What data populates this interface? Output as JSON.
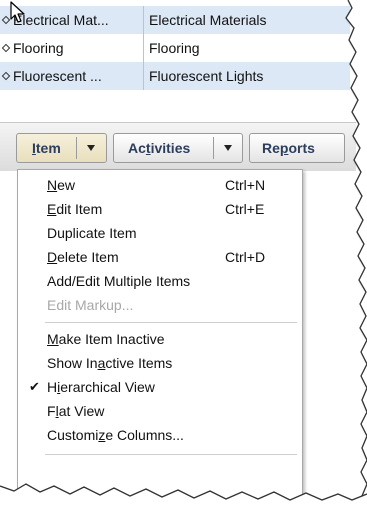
{
  "list": {
    "rows": [
      {
        "name": "Electrical Mat...",
        "description": "Electrical Materials"
      },
      {
        "name": "Flooring",
        "description": "Flooring"
      },
      {
        "name": "Fluorescent ...",
        "description": "Fluorescent Lights"
      }
    ]
  },
  "toolbar": {
    "item_pre": "",
    "item_u": "I",
    "item_post": "tem",
    "activities_pre": "Ac",
    "activities_u": "t",
    "activities_post": "ivities",
    "reports_pre": "Re",
    "reports_u": "p",
    "reports_post": "orts"
  },
  "menu": {
    "new": {
      "u": "N",
      "rest": "ew",
      "shortcut": "Ctrl+N"
    },
    "edit": {
      "u": "E",
      "rest": "dit Item",
      "shortcut": "Ctrl+E"
    },
    "duplicate": {
      "label": "Duplicate Item"
    },
    "delete": {
      "u": "D",
      "rest": "elete Item",
      "shortcut": "Ctrl+D"
    },
    "add_edit_multiple": {
      "label": "Add/Edit Multiple Items"
    },
    "edit_markup": {
      "label": "Edit Markup..."
    },
    "make_inactive": {
      "u": "M",
      "rest": "ake Item Inactive"
    },
    "show_inactive": {
      "pre": "Show In",
      "u": "a",
      "rest": "ctive Items"
    },
    "hierarchical": {
      "pre": "H",
      "u": "i",
      "rest": "erarchical View",
      "checkmark": "✔"
    },
    "flat": {
      "pre": "F",
      "u": "l",
      "rest": "at View"
    },
    "customize": {
      "pre": "Customi",
      "u": "z",
      "rest": "e Columns..."
    }
  },
  "colors": {
    "row_highlight": "#dde8f6",
    "toolbar_text": "#2c3e5c",
    "disabled_text": "#a8a8a8"
  }
}
